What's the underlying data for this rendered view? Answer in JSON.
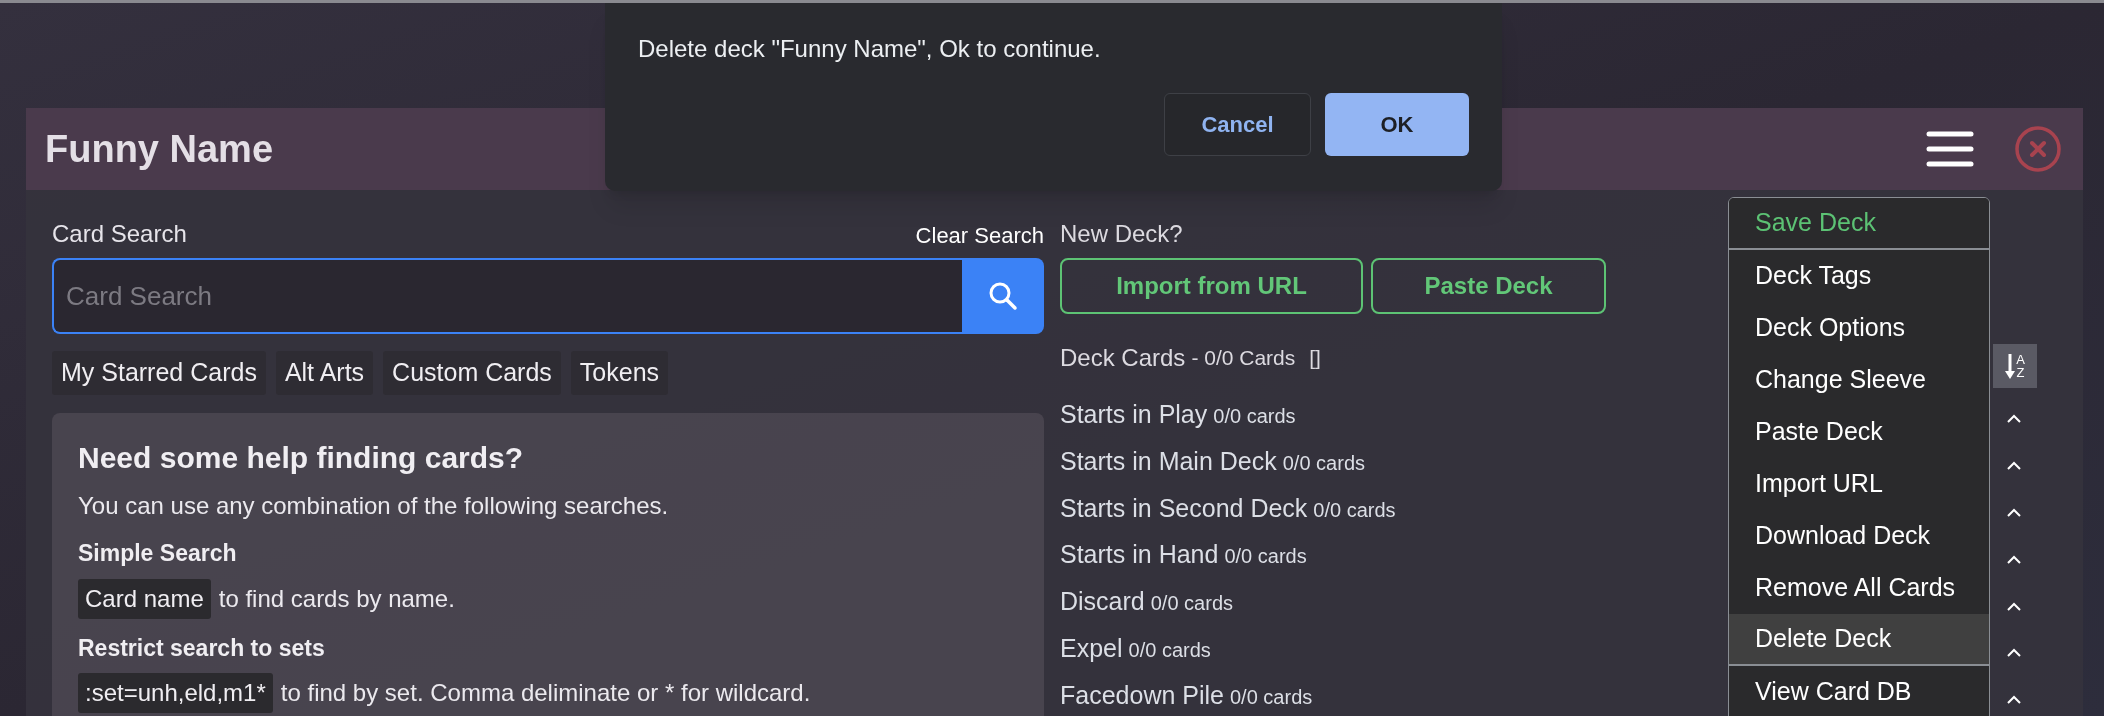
{
  "dialog": {
    "message": "Delete deck \"Funny Name\", Ok to continue.",
    "buttons": [
      {
        "label": "Cancel",
        "kind": "secondary"
      },
      {
        "label": "OK",
        "kind": "primary"
      }
    ]
  },
  "deck_window": {
    "title": "Funny Name"
  },
  "card_search": {
    "label": "Card Search",
    "clear_link": "Clear Search",
    "placeholder": "Card Search",
    "filters": [
      "My Starred Cards",
      "Alt Arts",
      "Custom Cards",
      "Tokens"
    ]
  },
  "help": {
    "heading": "Need some help finding cards?",
    "intro": "You can use any combination of the following searches.",
    "sections": [
      {
        "title": "Simple Search",
        "example": "Card name",
        "text": "to find cards by name."
      },
      {
        "title": "Restrict search to sets",
        "example": ":set=unh,eld,m1*",
        "text": "to find by set. Comma deliminate or * for wildcard."
      }
    ]
  },
  "new_deck": {
    "label": "New Deck?",
    "buttons": [
      "Import from URL",
      "Paste Deck"
    ]
  },
  "deck_cards": {
    "title": "Deck Cards",
    "count": "- 0/0 Cards",
    "tags": "[]",
    "sort_letters": [
      "A",
      "Z"
    ]
  },
  "zones": [
    {
      "name": "Starts in Play",
      "count": "0/0 cards"
    },
    {
      "name": "Starts in Main Deck",
      "count": "0/0 cards"
    },
    {
      "name": "Starts in Second Deck",
      "count": "0/0 cards"
    },
    {
      "name": "Starts in Hand",
      "count": "0/0 cards"
    },
    {
      "name": "Discard",
      "count": "0/0 cards"
    },
    {
      "name": "Expel",
      "count": "0/0 cards"
    },
    {
      "name": "Facedown Pile",
      "count": "0/0 cards"
    }
  ],
  "menu": {
    "items": [
      {
        "label": "Save Deck",
        "kind": "save",
        "selected": false,
        "separator_after": true
      },
      {
        "label": "Deck Tags",
        "kind": "plain",
        "selected": false,
        "separator_after": false
      },
      {
        "label": "Deck Options",
        "kind": "plain",
        "selected": false,
        "separator_after": false
      },
      {
        "label": "Change Sleeve",
        "kind": "plain",
        "selected": false,
        "separator_after": false
      },
      {
        "label": "Paste Deck",
        "kind": "plain",
        "selected": false,
        "separator_after": false
      },
      {
        "label": "Import URL",
        "kind": "plain",
        "selected": false,
        "separator_after": false
      },
      {
        "label": "Download Deck",
        "kind": "plain",
        "selected": false,
        "separator_after": false
      },
      {
        "label": "Remove All Cards",
        "kind": "plain",
        "selected": false,
        "separator_after": false
      },
      {
        "label": "Delete Deck",
        "kind": "plain",
        "selected": true,
        "separator_after": true
      },
      {
        "label": "View Card DB",
        "kind": "plain",
        "selected": false,
        "separator_after": false
      }
    ]
  }
}
